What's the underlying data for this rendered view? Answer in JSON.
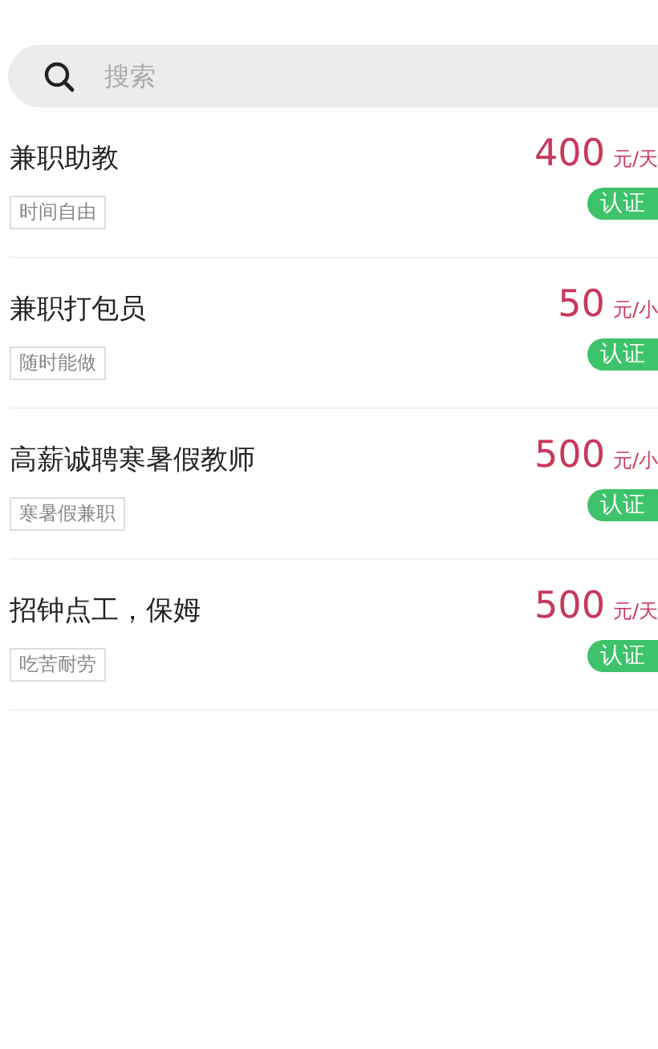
{
  "search": {
    "placeholder": "搜索"
  },
  "jobs": [
    {
      "title": "兼职助教",
      "tag": "时间自由",
      "amount": "400",
      "unit": "元/天",
      "badge": "认证"
    },
    {
      "title": "兼职打包员",
      "tag": "随时能做",
      "amount": "50",
      "unit": "元/小",
      "badge": "认证"
    },
    {
      "title": "高薪诚聘寒暑假教师",
      "tag": "寒暑假兼职",
      "amount": "500",
      "unit": "元/小",
      "badge": "认证"
    },
    {
      "title": "招钟点工，保姆",
      "tag": "吃苦耐劳",
      "amount": "500",
      "unit": "元/天",
      "badge": "认证"
    }
  ]
}
